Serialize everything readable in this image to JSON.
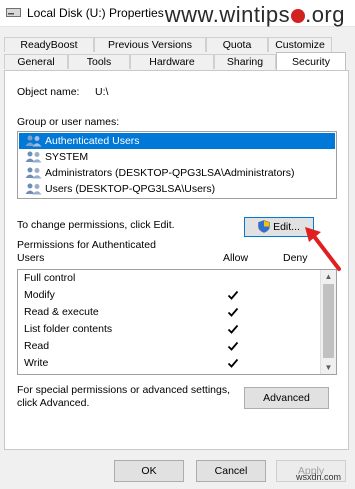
{
  "window": {
    "title": "Local Disk (U:) Properties",
    "watermark_prefix": "www.wintips",
    "watermark_suffix": ".org"
  },
  "tabs_top": [
    "ReadyBoost",
    "Previous Versions",
    "Quota",
    "Customize"
  ],
  "tabs_bottom": [
    "General",
    "Tools",
    "Hardware",
    "Sharing",
    "Security"
  ],
  "active_tab": "Security",
  "object": {
    "label": "Object name:",
    "value": "U:\\"
  },
  "group": {
    "label": "Group or user names:",
    "users": [
      "Authenticated Users",
      "SYSTEM",
      "Administrators (DESKTOP-QPG3LSA\\Administrators)",
      "Users (DESKTOP-QPG3LSA\\Users)"
    ],
    "selected": "Authenticated Users"
  },
  "change_text": "To change permissions, click Edit.",
  "edit_label": "Edit...",
  "permissions": {
    "title_line1": "Permissions for Authenticated",
    "title_line2": "Users",
    "allow_label": "Allow",
    "deny_label": "Deny",
    "rows": [
      {
        "name": "Full control",
        "allow": false,
        "deny": false
      },
      {
        "name": "Modify",
        "allow": true,
        "deny": false
      },
      {
        "name": "Read & execute",
        "allow": true,
        "deny": false
      },
      {
        "name": "List folder contents",
        "allow": true,
        "deny": false
      },
      {
        "name": "Read",
        "allow": true,
        "deny": false
      },
      {
        "name": "Write",
        "allow": true,
        "deny": false
      }
    ]
  },
  "special": {
    "line1": "For special permissions or advanced settings,",
    "line2": "click Advanced.",
    "advanced_label": "Advanced"
  },
  "buttons": {
    "ok": "OK",
    "cancel": "Cancel",
    "apply": "Apply"
  },
  "corner_mark": "wsxdn.com",
  "colors": {
    "selection": "#0078d7",
    "annotation_arrow": "#e02020"
  }
}
